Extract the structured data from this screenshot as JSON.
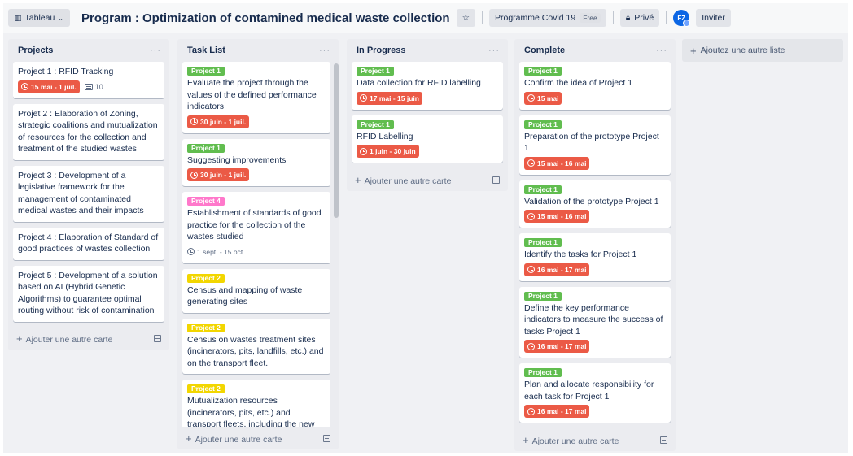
{
  "header": {
    "view_label": "Tableau",
    "board_title": "Program : Optimization of contamined medical waste collection",
    "workspace": "Programme Covid 19",
    "plan_badge": "Free",
    "visibility": "Privé",
    "avatar_initials": "FZ",
    "invite_label": "Inviter"
  },
  "add_list_label": "Ajoutez une autre liste",
  "add_card_label": "Ajouter une autre carte",
  "lists": [
    {
      "title": "Projects",
      "cards": [
        {
          "text": "Project 1 : RFID Tracking",
          "due": "15 mai - 1 juil.",
          "desc_count": "10"
        },
        {
          "text": "Projet 2 : Elaboration of Zoning, strategic coalitions and mutualization of resources for the collection and treatment of the studied wastes"
        },
        {
          "text": "Project 3 : Development of a legislative framework for the management of contaminated medical wastes and their impacts"
        },
        {
          "text": "Project 4 : Elaboration of Standard of good practices of wastes collection"
        },
        {
          "text": "Project 5 : Development of a solution based on AI (Hybrid Genetic Algorithms) to guarantee optimal routing without risk of contamination"
        }
      ]
    },
    {
      "title": "Task List",
      "cards": [
        {
          "label": "Project 1",
          "text": "Evaluate the project through the values of the defined performance indicators",
          "due": "30 juin - 1 juil."
        },
        {
          "label": "Project 1",
          "text": "Suggesting improvements",
          "due": "30 juin - 1 juil."
        },
        {
          "label": "Project 4",
          "text": "Establishment of standards of good practice for the collection of the wastes studied",
          "due": "1 sept. - 15 oct."
        },
        {
          "label": "Project 2",
          "text": "Census and mapping of waste generating sites"
        },
        {
          "label": "Project 2",
          "text": "Census on wastes treatment sites (incinerators, pits, landfills, etc.) and on the transport fleet."
        },
        {
          "label": "Project 2",
          "text": "Mutualization resources (incinerators, pits, etc.) and transport fleets, including the new mobile medical"
        }
      ]
    },
    {
      "title": "In Progress",
      "cards": [
        {
          "label": "Project 1",
          "text": "Data collection for RFID labelling",
          "due": "17 mai - 15 juin"
        },
        {
          "label": "Project 1",
          "text": "RFID Labelling",
          "due": "1 juin - 30 juin"
        }
      ]
    },
    {
      "title": "Complete",
      "cards": [
        {
          "label": "Project 1",
          "text": "Confirm the idea of Project 1",
          "due": "15 mai"
        },
        {
          "label": "Project 1",
          "text": "Preparation of the prototype Project 1",
          "due": "15 mai - 16 mai"
        },
        {
          "label": "Project 1",
          "text": "Validation of the prototype Project 1",
          "due": "15 mai - 16 mai"
        },
        {
          "label": "Project 1",
          "text": "Identify the tasks for Project 1",
          "due": "16 mai - 17 mai"
        },
        {
          "label": "Project 1",
          "text": "Define the key performance indicators to measure the success of tasks Project 1",
          "due": "16 mai - 17 mai"
        },
        {
          "label": "Project 1",
          "text": "Plan and allocate responsibility for each task for Project 1",
          "due": "16 mai - 17 mai"
        }
      ]
    }
  ],
  "colors": {
    "label_green": "#61bd4f",
    "label_pink": "#ff78cb",
    "label_yellow": "#f2d600",
    "due_red": "#eb5a46",
    "avatar_blue": "#0c66e4"
  }
}
